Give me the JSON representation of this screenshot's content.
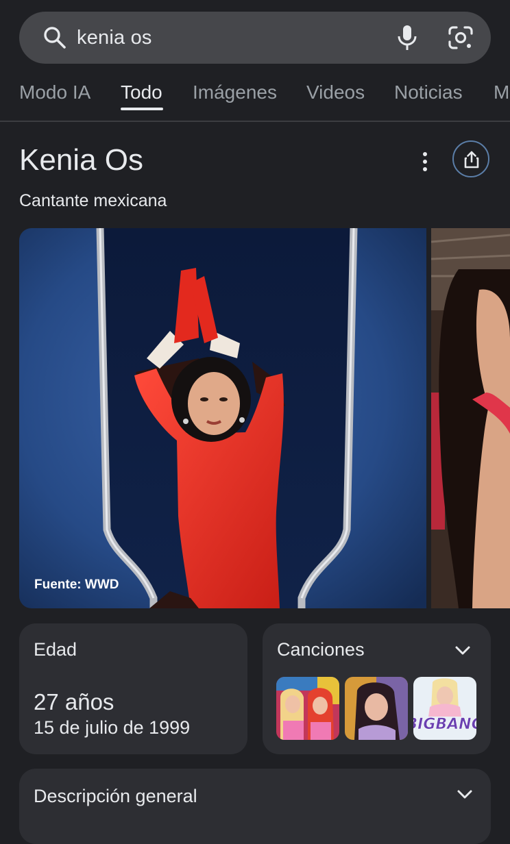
{
  "search": {
    "query": "kenia os",
    "icons": [
      "search-icon",
      "microphone-icon",
      "google-lens-icon"
    ]
  },
  "tabs": [
    {
      "label": "Modo IA",
      "active": false
    },
    {
      "label": "Todo",
      "active": true
    },
    {
      "label": "Imágenes",
      "active": false
    },
    {
      "label": "Videos",
      "active": false
    },
    {
      "label": "Noticias",
      "active": false
    },
    {
      "label": "M",
      "active": false
    }
  ],
  "knowledge_panel": {
    "title": "Kenia Os",
    "subtitle": "Cantante mexicana",
    "actions": [
      "more-options-icon",
      "share-icon"
    ],
    "main_image_source": "Fuente: WWD"
  },
  "age_card": {
    "label": "Edad",
    "value": "27 años",
    "birth_date": "15 de julio de 1999"
  },
  "songs_card": {
    "label": "Canciones",
    "thumbnail_text": "BIGBANG"
  },
  "description_card": {
    "label": "Descripción general"
  },
  "colors": {
    "background": "#1f2024",
    "search_bar": "#46474b",
    "card": "#2d2e33",
    "text_primary": "#e8eaed",
    "text_secondary": "#9aa0a6",
    "share_ring": "#5b7ea8"
  }
}
